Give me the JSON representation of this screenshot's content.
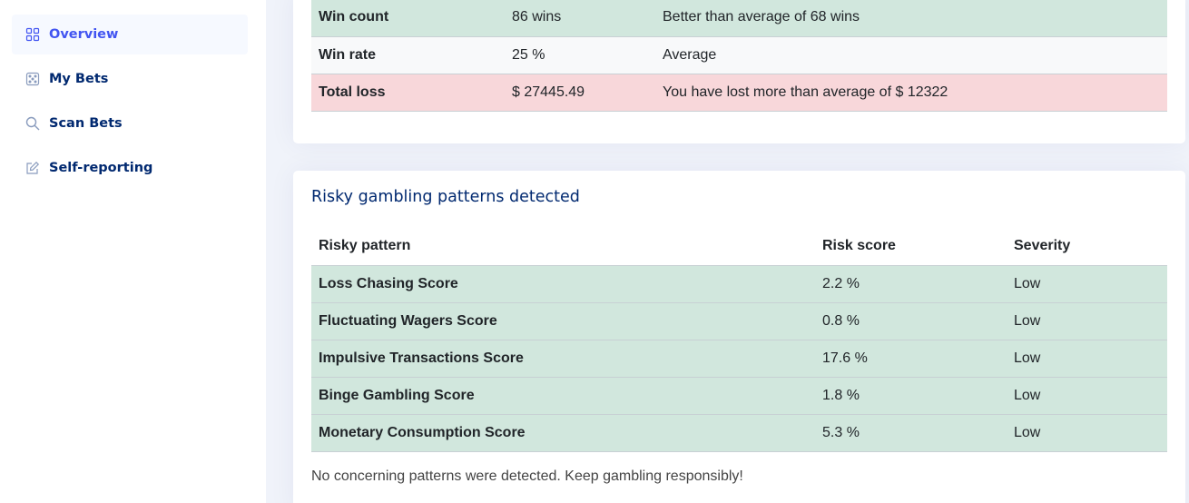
{
  "sidebar": {
    "items": [
      {
        "label": "Overview",
        "icon": "grid-icon",
        "active": true
      },
      {
        "label": "My Bets",
        "icon": "dice-icon",
        "active": false
      },
      {
        "label": "Scan Bets",
        "icon": "search-icon",
        "active": false
      },
      {
        "label": "Self-reporting",
        "icon": "pencil-square-icon",
        "active": false
      }
    ]
  },
  "stats": {
    "rows": [
      {
        "label": "Win count",
        "value": "86 wins",
        "comment": "Better than average of 68 wins"
      },
      {
        "label": "Win rate",
        "value": "25 %",
        "comment": "Average"
      },
      {
        "label": "Total loss",
        "value": "$ 27445.49",
        "comment": "You have lost more than average of $ 12322"
      }
    ]
  },
  "risk": {
    "title": "Risky gambling patterns detected",
    "headers": [
      "Risky pattern",
      "Risk score",
      "Severity"
    ],
    "rows": [
      {
        "pattern": "Loss Chasing Score",
        "score": "2.2 %",
        "severity": "Low"
      },
      {
        "pattern": "Fluctuating Wagers Score",
        "score": "0.8 %",
        "severity": "Low"
      },
      {
        "pattern": "Impulsive Transactions Score",
        "score": "17.6 %",
        "severity": "Low"
      },
      {
        "pattern": "Binge Gambling Score",
        "score": "1.8 %",
        "severity": "Low"
      },
      {
        "pattern": "Monetary Consumption Score",
        "score": "5.3 %",
        "severity": "Low"
      }
    ],
    "note": "No concerning patterns were detected. Keep gambling responsibly!"
  },
  "colors": {
    "accent": "#4154f1",
    "nav_text": "#012970",
    "row_green": "#d1e7dd",
    "row_red": "#f8d7da",
    "row_plain": "#f8f9fa"
  }
}
